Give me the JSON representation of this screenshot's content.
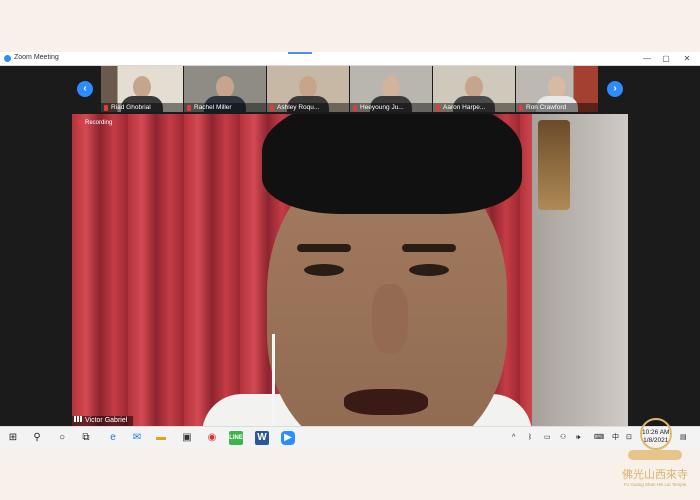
{
  "window": {
    "title": "Zoom Meeting",
    "controls": [
      "—",
      "▢",
      "✕"
    ]
  },
  "participants": [
    {
      "name": "Riad Ghobrial",
      "bg": "#d5cec4"
    },
    {
      "name": "Rachel Miller",
      "bg": "#8f8c86"
    },
    {
      "name": "Ashley Roqu...",
      "bg": "#c6b8a4"
    },
    {
      "name": "Heeyoung Ju...",
      "bg": "#b9b6b0"
    },
    {
      "name": "Aaron Harpe...",
      "bg": "#cfc9bb"
    },
    {
      "name": "Ron Crawford",
      "bg": "#bdb8b2"
    }
  ],
  "nav": {
    "prev": "‹",
    "next": "›"
  },
  "main_video": {
    "recording_label": "Recording",
    "speaker_name": "Victor Gabriel"
  },
  "taskbar": {
    "clock_time": "10:26 AM",
    "clock_date": "1/8/2021",
    "tray_ime": "中",
    "icons": [
      "windows-start",
      "search",
      "task-view",
      "cortana",
      "edge",
      "mail",
      "file-explorer",
      "store",
      "chrome",
      "line",
      "word",
      "zoom"
    ]
  },
  "watermark": {
    "text_cn": "佛光山西來寺",
    "text_en": "Fo Guang Shan Hsi Lai Temple"
  },
  "colors": {
    "accent": "#2d8cff",
    "recording": "#e23b3b"
  }
}
